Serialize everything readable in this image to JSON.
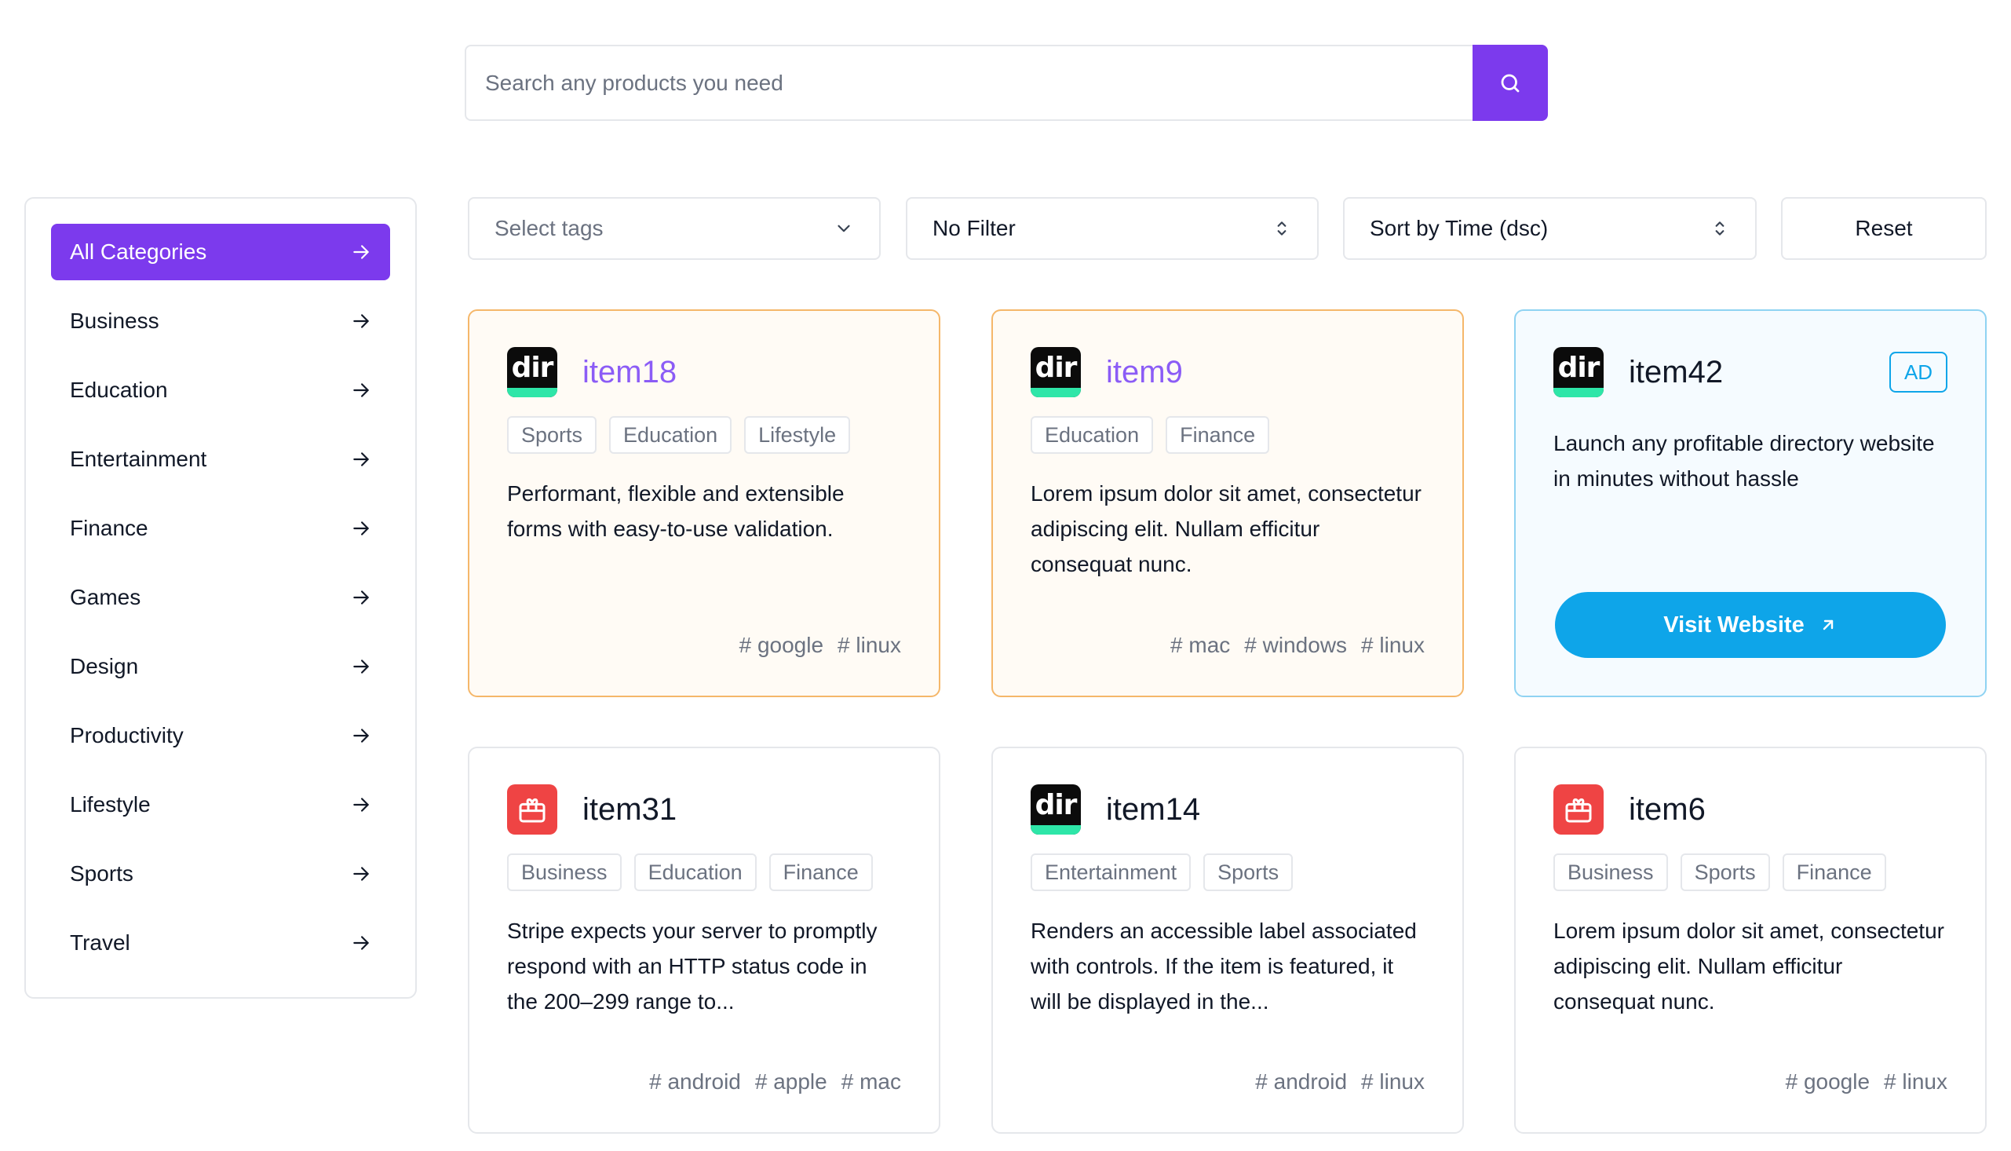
{
  "search": {
    "placeholder": "Search any products you need"
  },
  "sidebar": {
    "items": [
      {
        "label": "All Categories",
        "active": true
      },
      {
        "label": "Business"
      },
      {
        "label": "Education"
      },
      {
        "label": "Entertainment"
      },
      {
        "label": "Finance"
      },
      {
        "label": "Games"
      },
      {
        "label": "Design"
      },
      {
        "label": "Productivity"
      },
      {
        "label": "Lifestyle"
      },
      {
        "label": "Sports"
      },
      {
        "label": "Travel"
      }
    ]
  },
  "filters": {
    "tags_placeholder": "Select tags",
    "filter_value": "No Filter",
    "sort_value": "Sort by Time (dsc)",
    "reset_label": "Reset"
  },
  "cards": [
    {
      "title": "item18",
      "logo": "dir",
      "featured": true,
      "tags": [
        "Sports",
        "Education",
        "Lifestyle"
      ],
      "description": "Performant, flexible and extensible forms with easy-to-use validation.",
      "hashtags": [
        "google",
        "linux"
      ]
    },
    {
      "title": "item9",
      "logo": "dir",
      "featured": true,
      "tags": [
        "Education",
        "Finance"
      ],
      "description": "Lorem ipsum dolor sit amet, consectetur adipiscing elit. Nullam efficitur consequat nunc.",
      "hashtags": [
        "mac",
        "windows",
        "linux"
      ]
    },
    {
      "title": "item42",
      "logo": "dir",
      "ad": true,
      "ad_label": "AD",
      "description": "Launch any profitable directory website in minutes without hassle",
      "visit_label": "Visit Website"
    },
    {
      "title": "item31",
      "logo": "gift",
      "tags": [
        "Business",
        "Education",
        "Finance"
      ],
      "description": "Stripe expects your server to promptly respond with an HTTP status code in the 200–299 range to...",
      "hashtags": [
        "android",
        "apple",
        "mac"
      ]
    },
    {
      "title": "item14",
      "logo": "dir",
      "tags": [
        "Entertainment",
        "Sports"
      ],
      "description": "Renders an accessible label associated with controls. If the item is featured, it will be displayed in the...",
      "hashtags": [
        "android",
        "linux"
      ]
    },
    {
      "title": "item6",
      "logo": "gift",
      "tags": [
        "Business",
        "Sports",
        "Finance"
      ],
      "description": "Lorem ipsum dolor sit amet, consectetur adipiscing elit. Nullam efficitur consequat nunc.",
      "hashtags": [
        "google",
        "linux"
      ]
    }
  ],
  "logo_text": "dir",
  "colors": {
    "accent": "#7c3aed",
    "ad": "#0ea5e9",
    "featured_border": "#f5b76a"
  }
}
